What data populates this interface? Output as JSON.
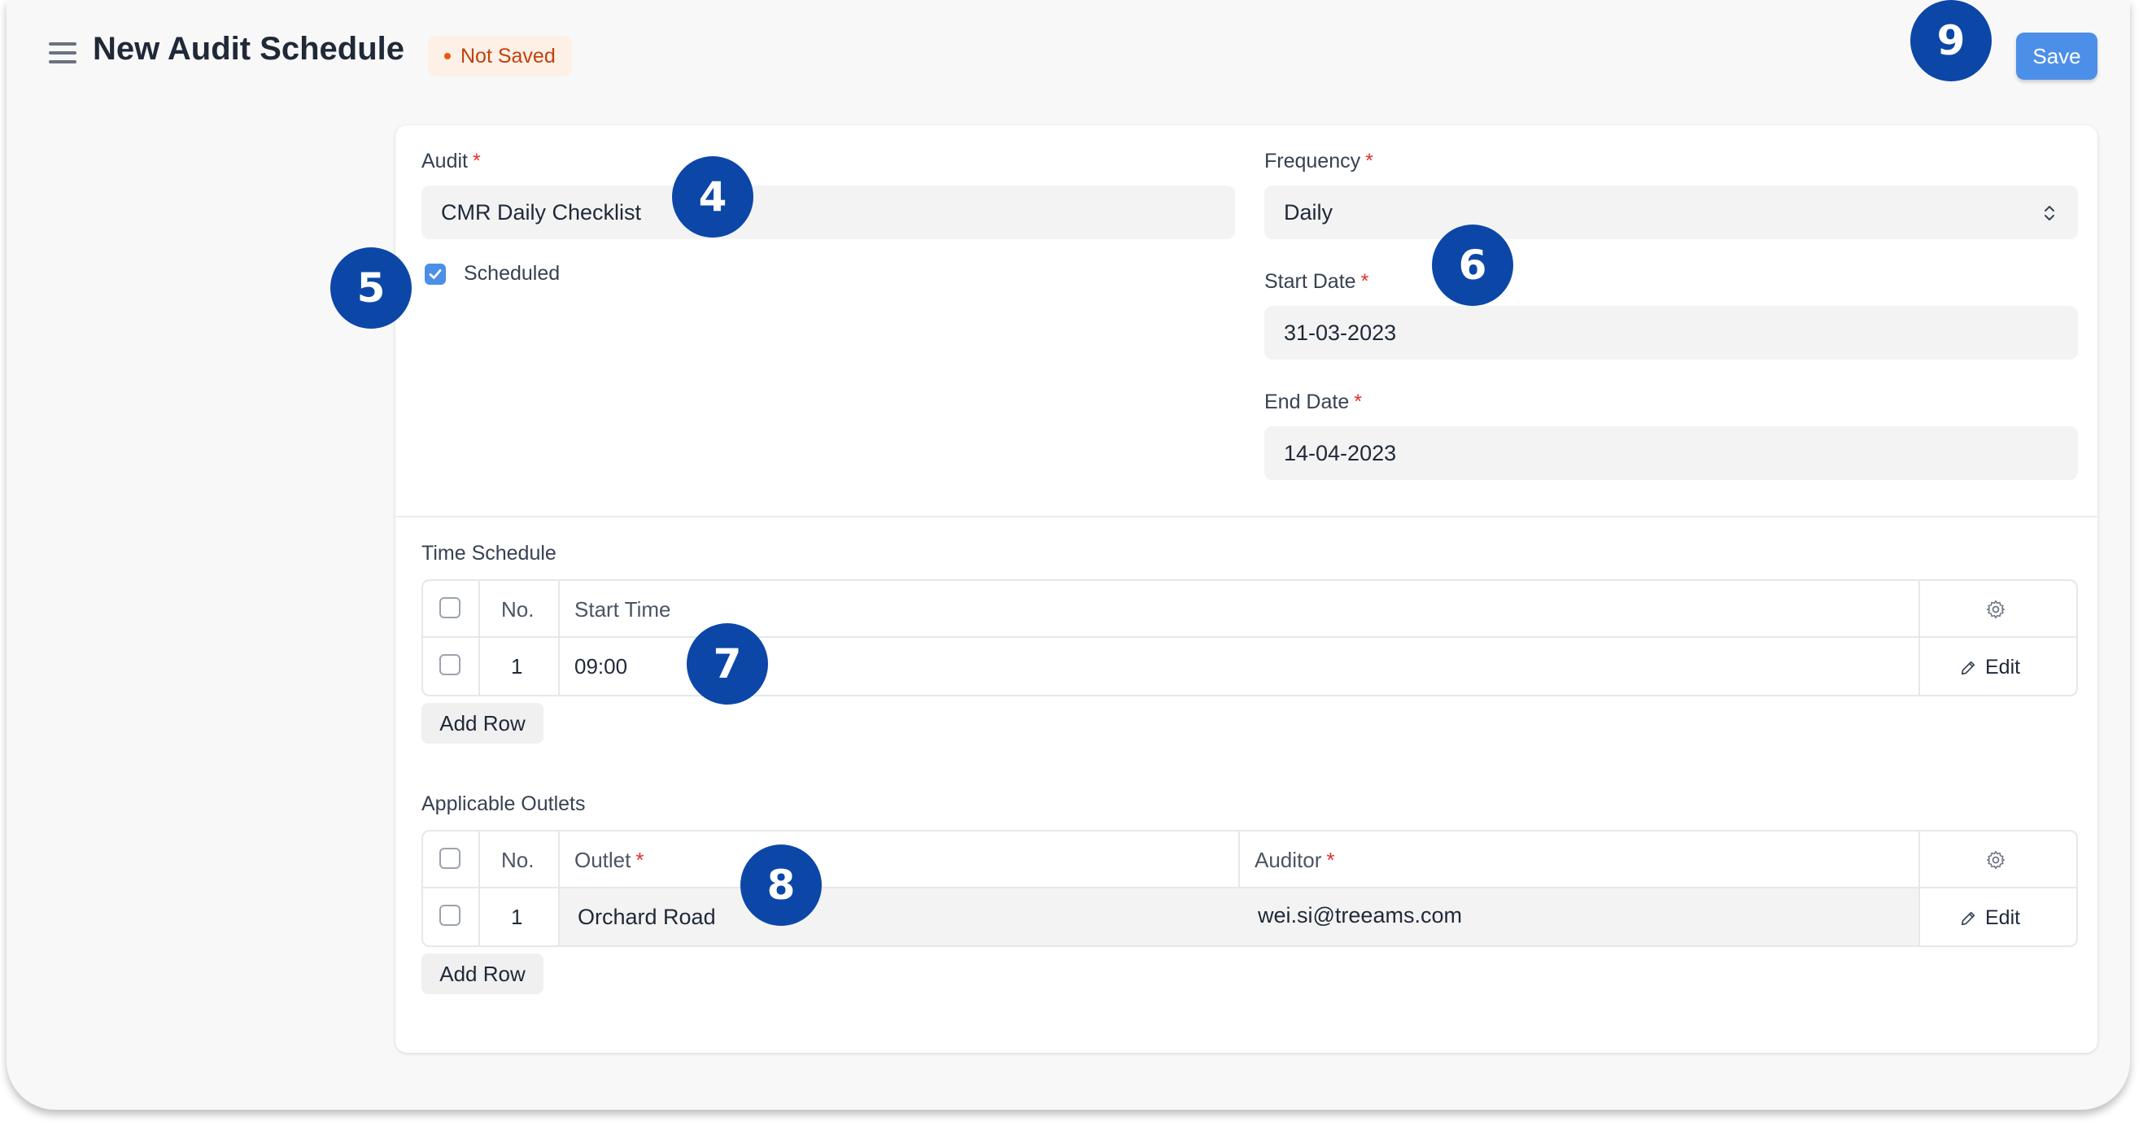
{
  "header": {
    "title": "New Audit Schedule",
    "status": "Not Saved",
    "save_label": "Save"
  },
  "form": {
    "audit": {
      "label": "Audit",
      "required": "*",
      "value": "CMR Daily Checklist"
    },
    "scheduled": {
      "label": "Scheduled",
      "checked": true
    },
    "frequency": {
      "label": "Frequency",
      "required": "*",
      "value": "Daily"
    },
    "start_date": {
      "label": "Start Date",
      "required": "*",
      "value": "31-03-2023"
    },
    "end_date": {
      "label": "End Date",
      "required": "*",
      "value": "14-04-2023"
    }
  },
  "time_schedule": {
    "label": "Time Schedule",
    "columns": {
      "no": "No.",
      "start_time": "Start Time"
    },
    "rows": [
      {
        "no": "1",
        "start_time": "09:00",
        "edit": "Edit"
      }
    ],
    "add_row": "Add Row"
  },
  "outlets": {
    "label": "Applicable Outlets",
    "columns": {
      "no": "No.",
      "outlet": "Outlet",
      "auditor": "Auditor",
      "required": "*"
    },
    "rows": [
      {
        "no": "1",
        "outlet": "Orchard Road",
        "auditor": "wei.si@treeams.com",
        "edit": "Edit"
      }
    ],
    "add_row": "Add Row"
  },
  "callouts": [
    "4",
    "5",
    "6",
    "7",
    "8",
    "9"
  ],
  "colors": {
    "primary": "#4c8fe8",
    "callout": "#0c47a8",
    "status": "#c2410c",
    "required": "#e03131"
  },
  "icons": [
    "menu-icon",
    "select-arrows-icon",
    "check-icon",
    "gear-icon",
    "pencil-icon"
  ]
}
